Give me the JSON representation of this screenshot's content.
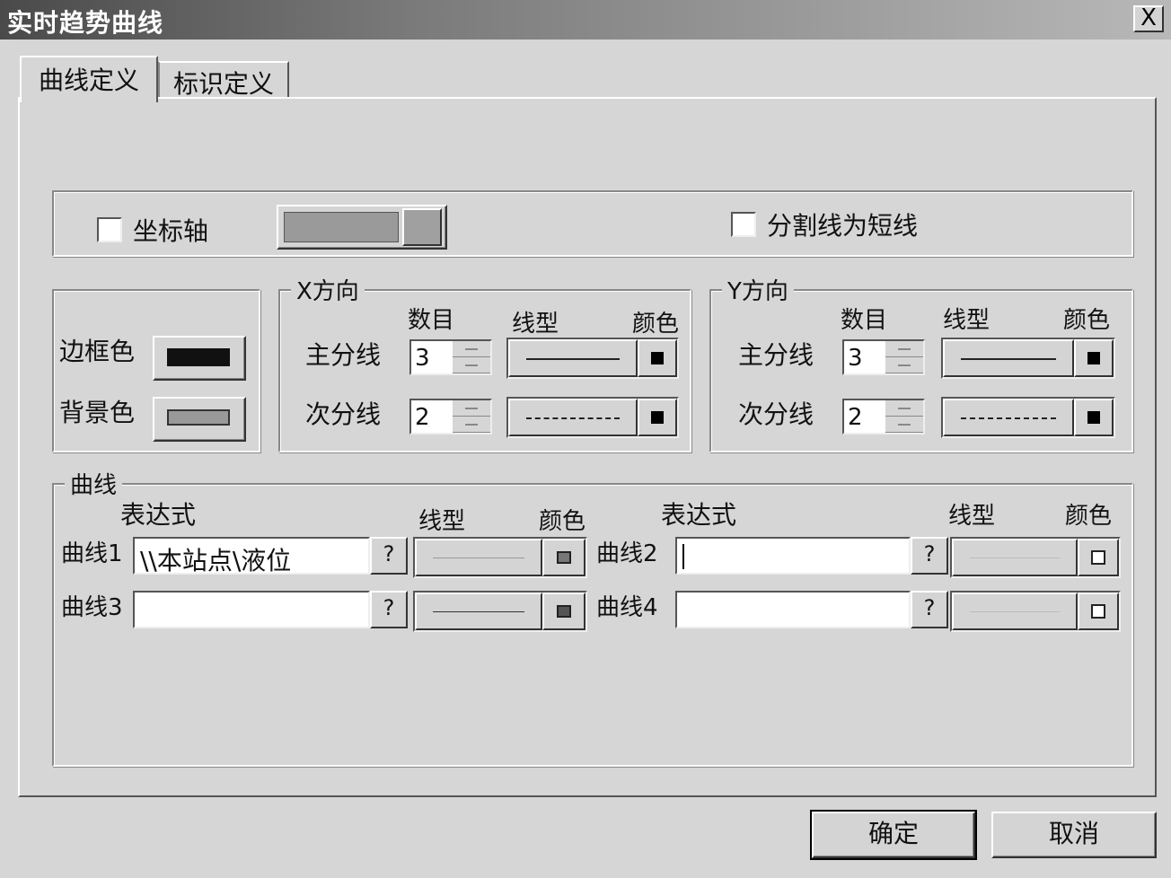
{
  "window": {
    "title": "实时趋势曲线",
    "close_label": "X"
  },
  "tabs": [
    {
      "label": "曲线定义",
      "active": true
    },
    {
      "label": "标识定义",
      "active": false
    }
  ],
  "axis_row": {
    "axis_label": "坐标轴",
    "axis_checked": false,
    "divider_label": "分割线为短线",
    "divider_checked": false
  },
  "colors_group": {
    "border_label": "边框色",
    "background_label": "背景色"
  },
  "x_group": {
    "legend": "X方向",
    "col_count": "数目",
    "col_linetype": "线型",
    "col_color": "颜色",
    "major_label": "主分线",
    "major_count": "3",
    "minor_label": "次分线",
    "minor_count": "2"
  },
  "y_group": {
    "legend": "Y方向",
    "col_count": "数目",
    "col_linetype": "线型",
    "col_color": "颜色",
    "major_label": "主分线",
    "major_count": "3",
    "minor_label": "次分线",
    "minor_count": "2"
  },
  "curves_group": {
    "legend": "曲线",
    "left_header_expr": "表达式",
    "left_header_linetype": "线型",
    "left_header_color": "颜色",
    "right_header_expr": "表达式",
    "right_header_linetype": "线型",
    "right_header_color": "颜色",
    "curves": [
      {
        "label": "曲线1",
        "expression": "\\\\本站点\\液位",
        "q": "?"
      },
      {
        "label": "曲线2",
        "expression": "",
        "q": "?"
      },
      {
        "label": "曲线3",
        "expression": "",
        "q": "?"
      },
      {
        "label": "曲线4",
        "expression": "",
        "q": "?"
      }
    ]
  },
  "buttons": {
    "ok": "确定",
    "cancel": "取消"
  },
  "colors": {
    "border_swatch": "#111111",
    "background_swatch": "#999999",
    "axis_swatch": "#9a9a9a"
  }
}
